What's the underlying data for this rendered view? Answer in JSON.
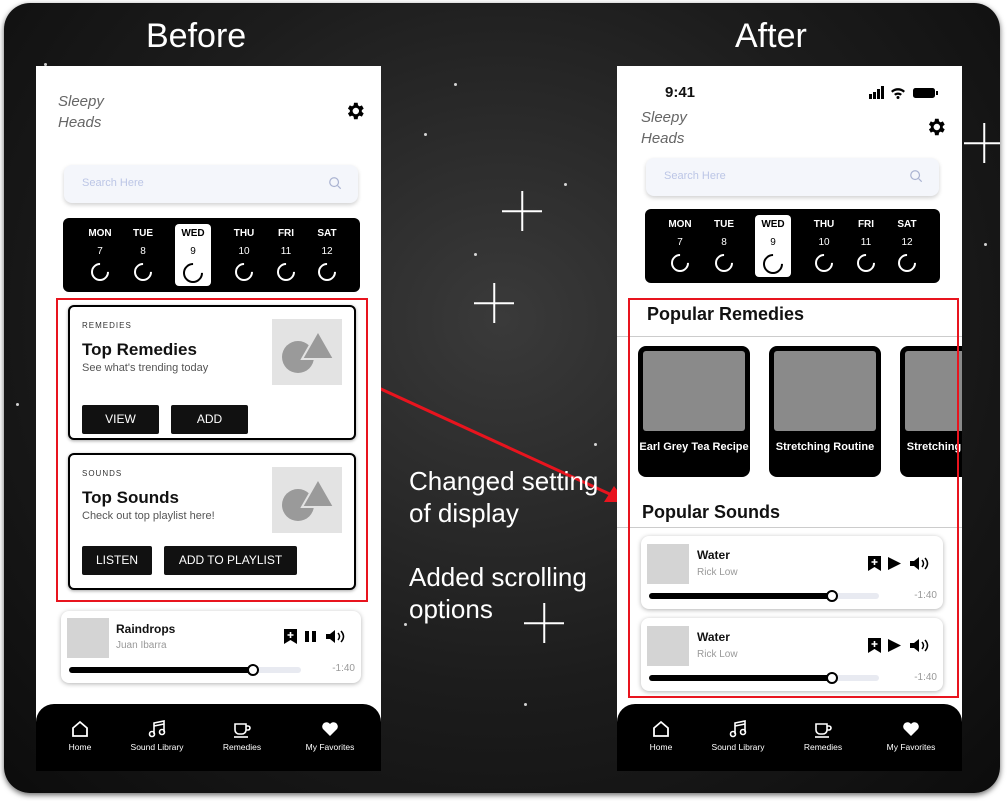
{
  "labels": {
    "before": "Before",
    "after": "After"
  },
  "annotation": {
    "line1": "Changed setting",
    "line2": "of display",
    "line3": "Added scrolling",
    "line4": "options"
  },
  "colors": {
    "highlight": "#e8141e",
    "dark": "#000000",
    "tile_image": "#8a8a8a"
  },
  "app": {
    "brand_line1": "Sleepy",
    "brand_line2": "Heads",
    "settings_icon": "gear-icon"
  },
  "search": {
    "placeholder": "Search Here",
    "icon": "search-icon"
  },
  "week": [
    {
      "name": "MON",
      "date": "7",
      "selected": false
    },
    {
      "name": "TUE",
      "date": "8",
      "selected": false
    },
    {
      "name": "WED",
      "date": "9",
      "selected": true
    },
    {
      "name": "THU",
      "date": "10",
      "selected": false
    },
    {
      "name": "FRI",
      "date": "11",
      "selected": false
    },
    {
      "name": "SAT",
      "date": "12",
      "selected": false
    }
  ],
  "before": {
    "remedies_card": {
      "overline": "REMEDIES",
      "title": "Top Remedies",
      "subtitle": "See what's trending today",
      "buttons": [
        "VIEW",
        "ADD"
      ]
    },
    "sounds_card": {
      "overline": "SOUNDS",
      "title": "Top Sounds",
      "subtitle": "Check out top playlist here!",
      "buttons": [
        "LISTEN",
        "ADD TO PLAYLIST"
      ]
    },
    "player": {
      "title": "Raindrops",
      "artist": "Juan Ibarra",
      "time": "-1:40",
      "progress": 0.79,
      "state": "playing"
    }
  },
  "after": {
    "status_time": "9:41",
    "remedies_heading": "Popular Remedies",
    "remedy_tiles": [
      "Earl Grey Tea Recipe",
      "Stretching Routine",
      "Stretching Routine"
    ],
    "sounds_heading": "Popular Sounds",
    "players": [
      {
        "title": "Water",
        "artist": "Rick Low",
        "time": "-1:40",
        "progress": 0.79,
        "state": "paused"
      },
      {
        "title": "Water",
        "artist": "Rick Low",
        "time": "-1:40",
        "progress": 0.79,
        "state": "paused"
      }
    ]
  },
  "nav": [
    {
      "label": "Home",
      "icon": "home-icon"
    },
    {
      "label": "Sound Library",
      "icon": "music-note-icon"
    },
    {
      "label": "Remedies",
      "icon": "cup-icon"
    },
    {
      "label": "My Favorites",
      "icon": "heart-icon"
    }
  ]
}
